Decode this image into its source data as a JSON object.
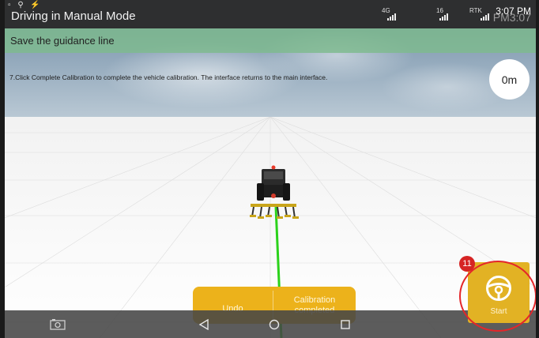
{
  "status_bar": {
    "title": "Driving in Manual Mode",
    "signal_1": "4G",
    "signal_2": "16",
    "signal_3": "RTK",
    "time": "3:07 PM",
    "time_ghost": "PM3:07"
  },
  "guidance": {
    "label": "Save the guidance line"
  },
  "instruction": {
    "text": "7.Click Complete Calibration to complete the vehicle calibration. The interface returns to the main interface."
  },
  "distance": {
    "value": "0m"
  },
  "actions": {
    "undo_label": "Undo",
    "calibration_label": "Calibration completed"
  },
  "start": {
    "label": "Start",
    "icon": "steering-wheel-icon"
  },
  "annotation": {
    "step": "11",
    "color": "#e4262a"
  },
  "nav": {
    "screenshot_icon": "camera-icon",
    "back_icon": "back-triangle-icon",
    "home_icon": "home-circle-icon",
    "recents_icon": "recents-square-icon"
  },
  "colors": {
    "accent": "#ecb21b",
    "guidance_bar": "#7ebb8d",
    "guide_line": "#2bd21b"
  }
}
